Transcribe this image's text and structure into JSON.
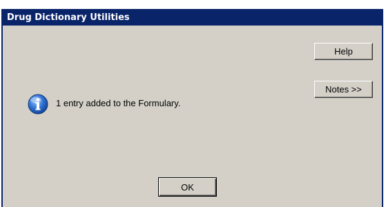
{
  "window": {
    "title": "Drug Dictionary Utilities"
  },
  "buttons": {
    "help_label": "Help",
    "notes_label": "Notes >>",
    "ok_label": "OK"
  },
  "message": {
    "text": "1 entry added to the Formulary.",
    "icon": "information-icon"
  },
  "colors": {
    "titlebar": "#0a246a",
    "dialog_background": "#d4d0c8",
    "icon_blue": "#1f5fbf"
  }
}
